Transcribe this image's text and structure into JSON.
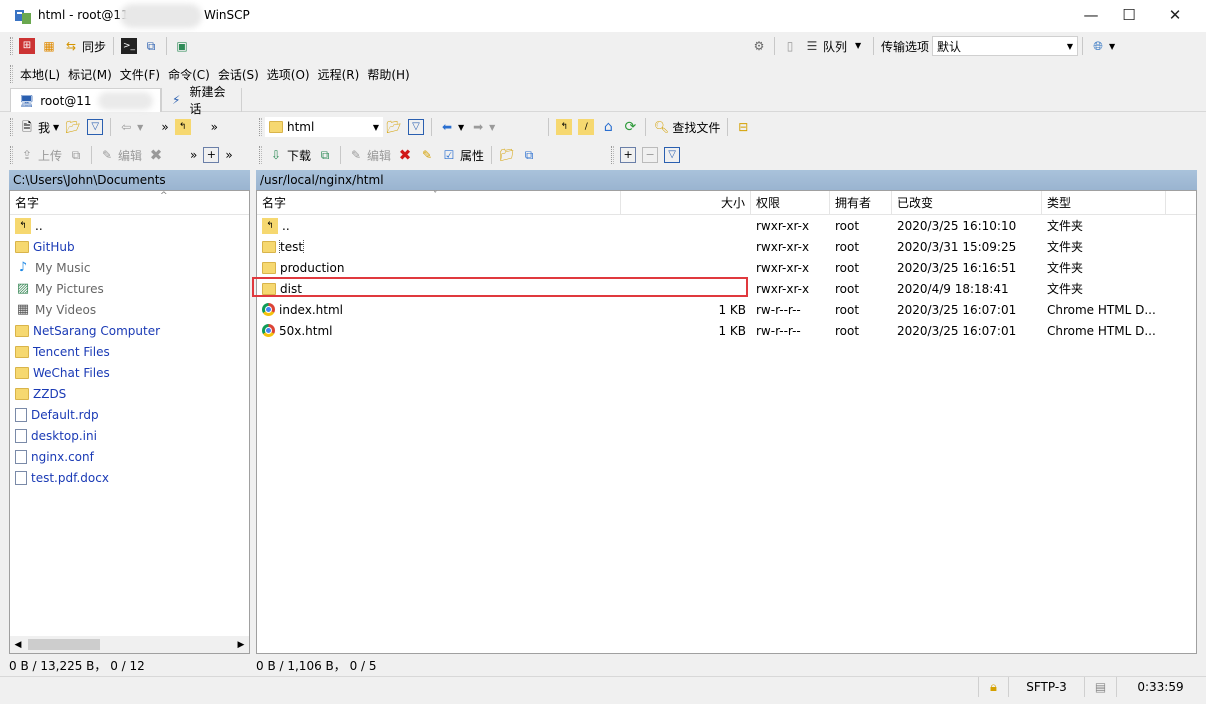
{
  "window": {
    "title": "html - root@11",
    "app_name": "WinSCP",
    "minimize": "—",
    "maximize": "☐",
    "close": "✕"
  },
  "toolbar1": {
    "sync_label": "同步",
    "queue_label": "队列",
    "transfer_options_label": "传输选项",
    "transfer_preset": "默认"
  },
  "menu": [
    "本地(L)",
    "标记(M)",
    "文件(F)",
    "命令(C)",
    "会话(S)",
    "选项(O)",
    "远程(R)",
    "帮助(H)"
  ],
  "tabs": {
    "session_label": "root@11",
    "new_session_label": "新建会话"
  },
  "local_toolbar": {
    "drive_label": "我",
    "upload_label": "上传",
    "edit_label": "编辑"
  },
  "remote_toolbar": {
    "dir_label": "html",
    "find_files_label": "查找文件",
    "download_label": "下载",
    "edit_label": "编辑",
    "properties_label": "属性"
  },
  "local": {
    "path": "C:\\Users\\John\\Documents",
    "col_name": "名字",
    "files": [
      {
        "name": "..",
        "icon": "parent-dir-icon",
        "kind": "parent"
      },
      {
        "name": "GitHub",
        "icon": "folder-icon",
        "kind": "folder"
      },
      {
        "name": "My Music",
        "icon": "music-folder-icon",
        "kind": "special"
      },
      {
        "name": "My Pictures",
        "icon": "pictures-folder-icon",
        "kind": "special"
      },
      {
        "name": "My Videos",
        "icon": "videos-folder-icon",
        "kind": "special"
      },
      {
        "name": "NetSarang Computer",
        "icon": "folder-icon",
        "kind": "folder"
      },
      {
        "name": "Tencent Files",
        "icon": "folder-icon",
        "kind": "folder"
      },
      {
        "name": "WeChat Files",
        "icon": "folder-icon",
        "kind": "folder"
      },
      {
        "name": "ZZDS",
        "icon": "folder-icon",
        "kind": "folder"
      },
      {
        "name": "Default.rdp",
        "icon": "rdp-file-icon",
        "kind": "file"
      },
      {
        "name": "desktop.ini",
        "icon": "ini-file-icon",
        "kind": "file"
      },
      {
        "name": "nginx.conf",
        "icon": "conf-file-icon",
        "kind": "file"
      },
      {
        "name": "test.pdf.docx",
        "icon": "docx-file-icon",
        "kind": "file"
      }
    ],
    "status": "0 B / 13,225 B， 0 / 12"
  },
  "remote": {
    "path": "/usr/local/nginx/html",
    "columns": {
      "name": "名字",
      "size": "大小",
      "perms": "权限",
      "owner": "拥有者",
      "changed": "已改变",
      "type": "类型"
    },
    "files": [
      {
        "name": "..",
        "size": "",
        "perms": "rwxr-xr-x",
        "owner": "root",
        "changed": "2020/3/25 16:10:10",
        "type": "文件夹",
        "kind": "parent"
      },
      {
        "name": "test",
        "size": "",
        "perms": "rwxr-xr-x",
        "owner": "root",
        "changed": "2020/3/31 15:09:25",
        "type": "文件夹",
        "kind": "folder"
      },
      {
        "name": "production",
        "size": "",
        "perms": "rwxr-xr-x",
        "owner": "root",
        "changed": "2020/3/25 16:16:51",
        "type": "文件夹",
        "kind": "folder"
      },
      {
        "name": "dist",
        "size": "",
        "perms": "rwxr-xr-x",
        "owner": "root",
        "changed": "2020/4/9 18:18:41",
        "type": "文件夹",
        "kind": "folder"
      },
      {
        "name": "index.html",
        "size": "1 KB",
        "perms": "rw-r--r--",
        "owner": "root",
        "changed": "2020/3/25 16:07:01",
        "type": "Chrome HTML D...",
        "kind": "html"
      },
      {
        "name": "50x.html",
        "size": "1 KB",
        "perms": "rw-r--r--",
        "owner": "root",
        "changed": "2020/3/25 16:07:01",
        "type": "Chrome HTML D...",
        "kind": "html"
      }
    ],
    "status": "0 B / 1,106 B， 0 / 5"
  },
  "statusbar": {
    "protocol": "SFTP-3",
    "elapsed": "0:33:59"
  },
  "colors": {
    "highlight_box": "#e0393e",
    "path_bar": "#a9c2db",
    "link_text": "#1a3ab5"
  }
}
